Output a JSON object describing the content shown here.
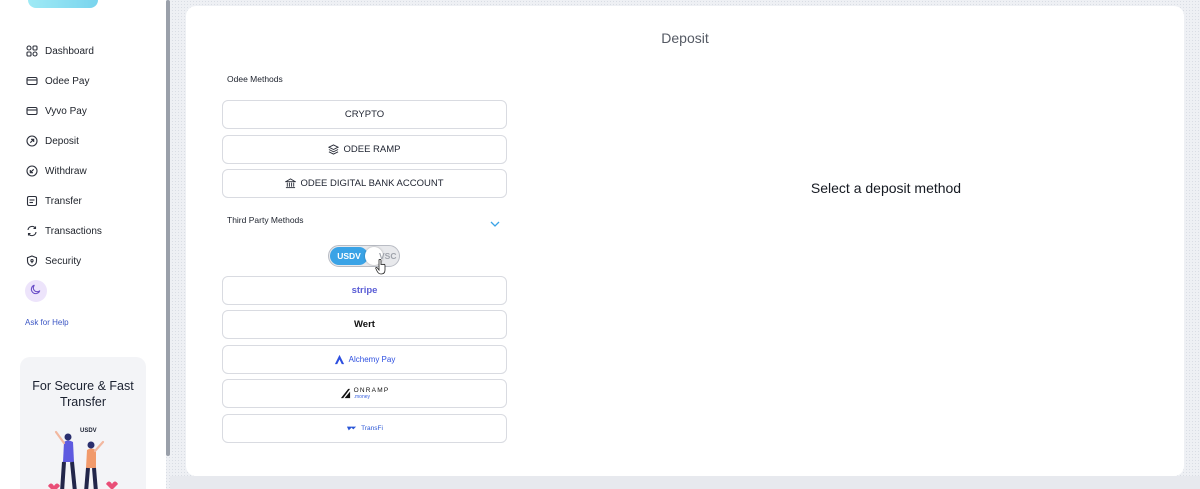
{
  "sidebar": {
    "items": [
      {
        "label": "Dashboard",
        "icon": "dashboard-icon"
      },
      {
        "label": "Odee Pay",
        "icon": "card-icon"
      },
      {
        "label": "Vyvo Pay",
        "icon": "card-icon"
      },
      {
        "label": "Deposit",
        "icon": "deposit-icon"
      },
      {
        "label": "Withdraw",
        "icon": "withdraw-icon"
      },
      {
        "label": "Transfer",
        "icon": "transfer-icon"
      },
      {
        "label": "Transactions",
        "icon": "transactions-icon"
      },
      {
        "label": "Security",
        "icon": "shield-icon"
      }
    ],
    "help_label": "Ask for Help",
    "promo": {
      "line1": "For Secure & Fast",
      "line2": "Transfer",
      "art_text": "USDV"
    }
  },
  "main": {
    "title": "Deposit",
    "odee_section_label": "Odee Methods",
    "odee_methods": [
      {
        "label": "CRYPTO"
      },
      {
        "label": "ODEE RAMP",
        "icon": "layers-icon"
      },
      {
        "label": "ODEE DIGITAL BANK ACCOUNT",
        "icon": "bank-icon"
      }
    ],
    "third_party_label": "Third Party Methods",
    "currency_toggle": {
      "on": "USDV",
      "off": "VSC"
    },
    "third_party_methods": {
      "stripe": "stripe",
      "wert": "Wert",
      "alchemy": "Alchemy Pay",
      "onramp_main": "ONRAMP",
      "onramp_sub": ".money",
      "transfi": "TransFi"
    },
    "placeholder": "Select a deposit method"
  },
  "colors": {
    "accent": "#3aa3e6",
    "help_link": "#3b56c4",
    "stripe": "#5b5ed6",
    "alchemy": "#2d4fe0"
  }
}
